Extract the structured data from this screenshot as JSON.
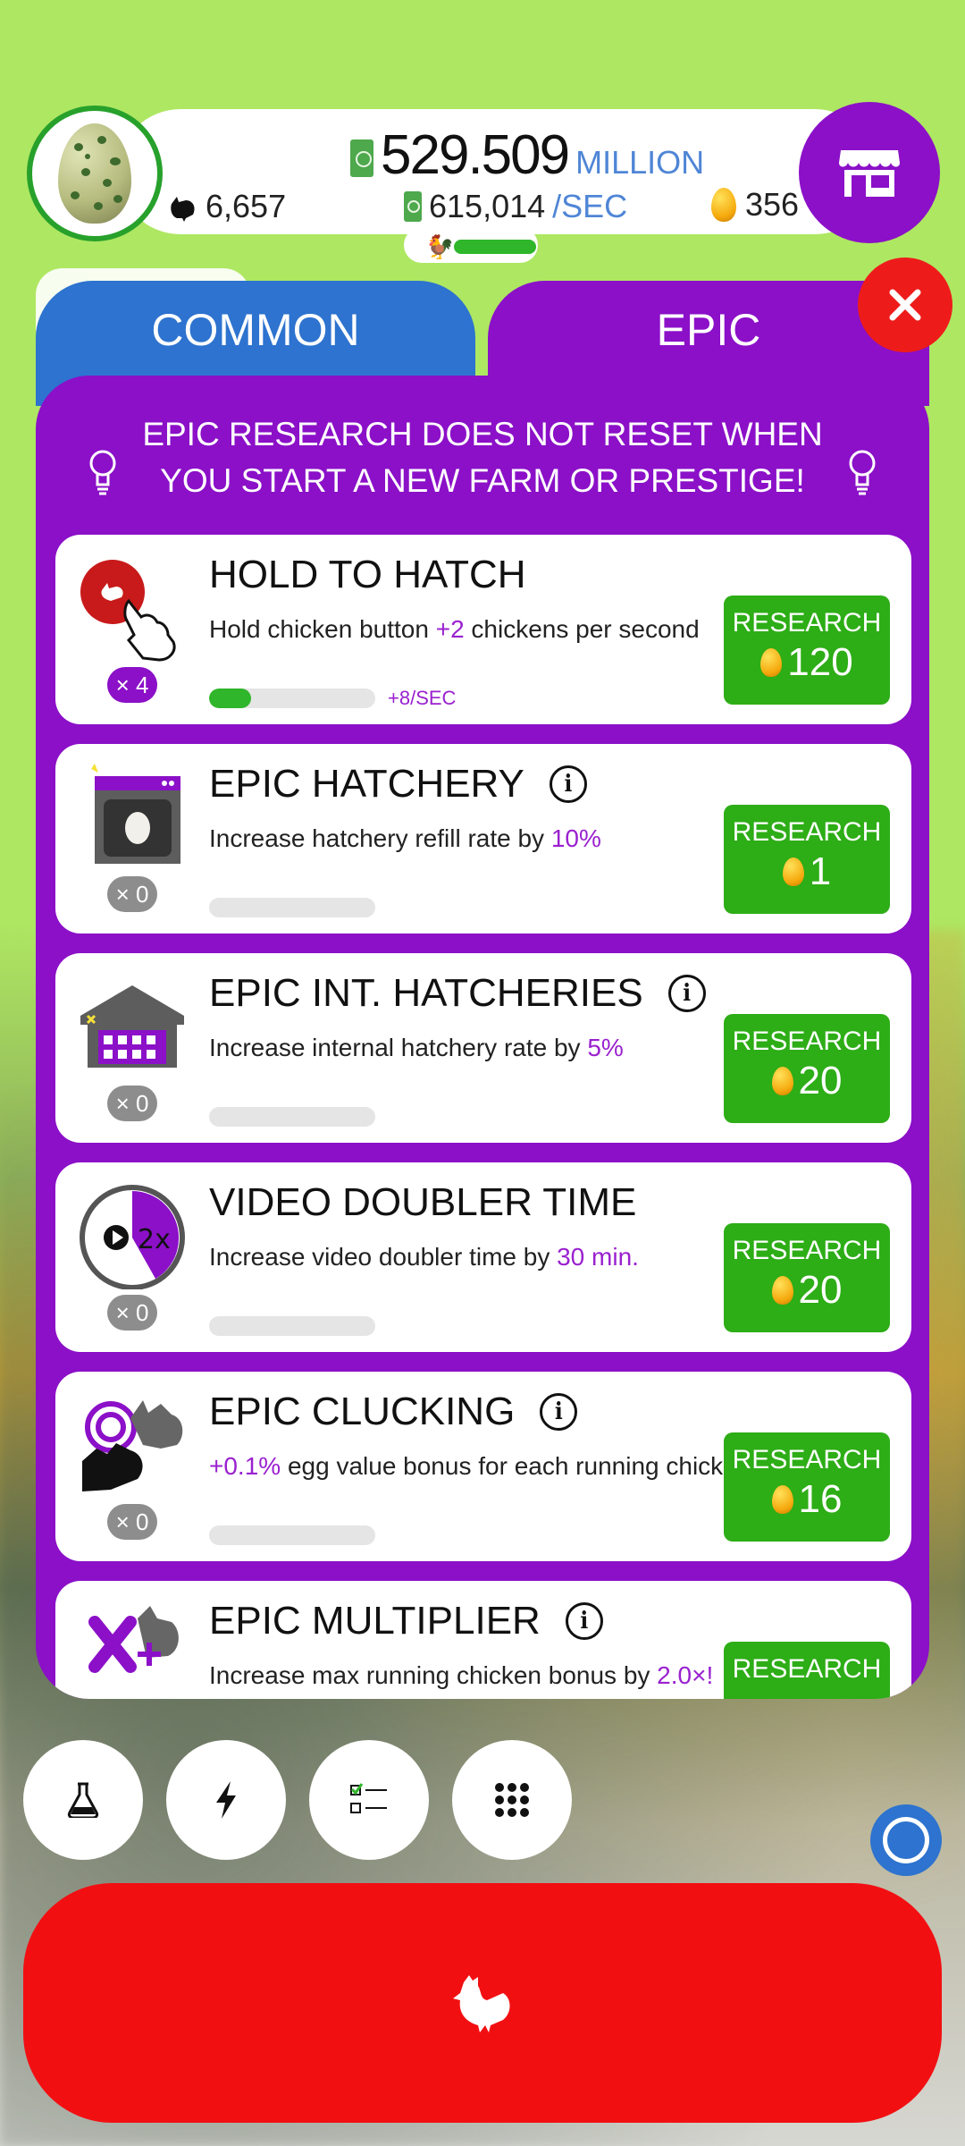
{
  "header": {
    "money_value": "529.509",
    "money_unit": "MILLION",
    "rate_value": "615,014",
    "rate_unit": "/SEC",
    "chickens": "6,657",
    "golden_eggs": "356",
    "hatchery_fill": 0.85
  },
  "tabs": {
    "common": "COMMON",
    "epic": "EPIC"
  },
  "notice": "EPIC RESEARCH DOES NOT RESET WHEN YOU START A NEW FARM OR PRESTIGE!",
  "research_label": "RESEARCH",
  "items": [
    {
      "name": "HOLD TO HATCH",
      "desc_pre": "Hold chicken button ",
      "desc_hl": "+2",
      "desc_post": " chickens per second",
      "level": "× 4",
      "progress": 0.25,
      "progress_label": "+8/SEC",
      "cost": "120",
      "info": false
    },
    {
      "name": "EPIC HATCHERY",
      "desc_pre": "Increase hatchery refill rate by ",
      "desc_hl": "10%",
      "desc_post": "",
      "level": "× 0",
      "progress": 0,
      "progress_label": "",
      "cost": "1",
      "info": true
    },
    {
      "name": "EPIC INT. HATCHERIES",
      "desc_pre": "Increase internal hatchery rate by ",
      "desc_hl": "5%",
      "desc_post": "",
      "level": "× 0",
      "progress": 0,
      "progress_label": "",
      "cost": "20",
      "info": true
    },
    {
      "name": "VIDEO DOUBLER TIME",
      "desc_pre": "Increase video doubler time by ",
      "desc_hl": "30 min.",
      "desc_post": "",
      "level": "× 0",
      "progress": 0,
      "progress_label": "",
      "cost": "20",
      "info": false
    },
    {
      "name": "EPIC CLUCKING",
      "desc_pre": "",
      "desc_hl": "+0.1%",
      "desc_post": " egg value bonus for each running chicken.",
      "level": "× 0",
      "progress": 0,
      "progress_label": "",
      "cost": "16",
      "info": true
    },
    {
      "name": "EPIC MULTIPLIER",
      "desc_pre": "Increase max running chicken bonus by ",
      "desc_hl": "2.0×!",
      "desc_post": "",
      "level": "",
      "progress": 0,
      "progress_label": "",
      "cost": "",
      "info": true
    }
  ],
  "icons": {
    "shop": "shop-icon",
    "close": "close-icon",
    "research": "flask-icon",
    "boost": "lightning-icon",
    "missions": "checklist-icon",
    "menu": "grid-icon",
    "hatch": "chicken-icon",
    "egg": "golden-egg-icon"
  },
  "colors": {
    "purple": "#8b10c8",
    "blue": "#2d73cf",
    "green": "#2dad16",
    "red": "#f20f12"
  }
}
